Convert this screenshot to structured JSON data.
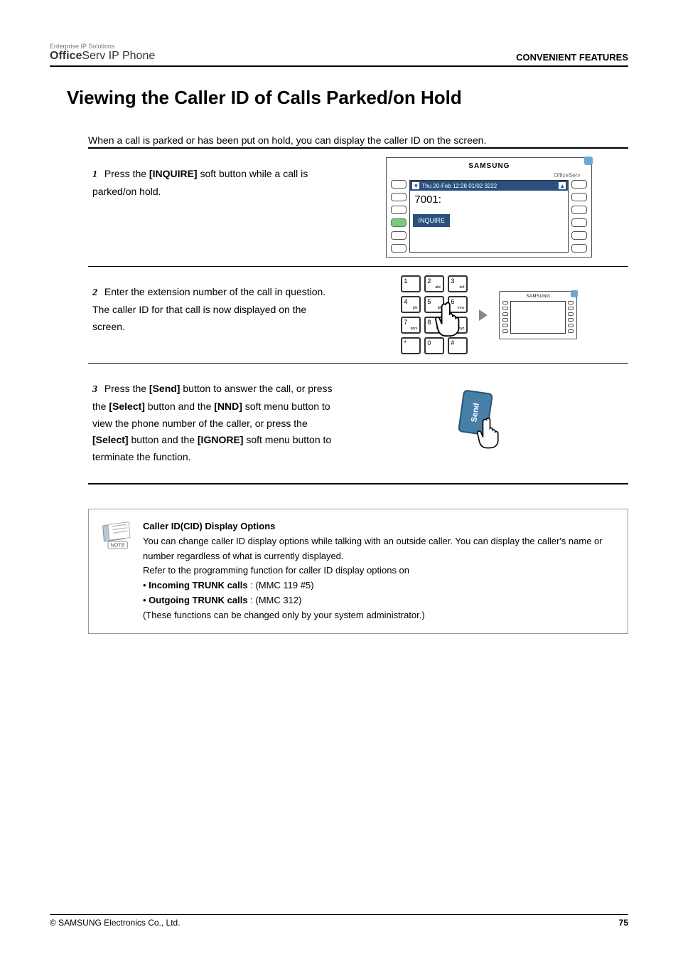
{
  "header": {
    "logo_sub": "Enterprise IP Solutions",
    "logo_main_a": "Office",
    "logo_main_b": "Serv",
    "logo_main_c": " IP Phone",
    "section": "CONVENIENT FEATURES"
  },
  "title": "Viewing the Caller ID of Calls Parked/on Hold",
  "intro": "When a call is parked or has been put on hold, you can display the caller ID on the screen.",
  "step1": {
    "num": "1",
    "text_a": "Press the ",
    "bracket": "[INQUIRE]",
    "text_b": " soft button while a call is parked/on hold."
  },
  "step2": {
    "num": "2",
    "text": "Enter the extension number of the call in question. The caller ID for that call is now displayed on the screen."
  },
  "step3": {
    "num": "3",
    "text_a": "Press the ",
    "send": "[Send]",
    "text_b": " button to answer the call, or press the ",
    "select1": "[Select]",
    "text_c": " button and the ",
    "nnd": "[NND]",
    "text_d": " soft menu button to view the phone number of the caller, or press the ",
    "select2": "[Select]",
    "text_e": " button and the ",
    "ignore": "[IGNORE]",
    "text_f": " soft menu button to terminate the function."
  },
  "phone1": {
    "brand": "SAMSUNG",
    "subtitle": "OfficeServ",
    "topbar": "Thu 20-Feb 12:28  01/02       3222",
    "line1": "7001:",
    "inquire": "INQUIRE"
  },
  "keys": [
    "1",
    "2",
    "3",
    "4",
    "5",
    "6",
    "7",
    "8",
    "9",
    "*",
    "0",
    "#"
  ],
  "key_subs": [
    "",
    "abc",
    "def",
    "ghi",
    "jkl",
    "mno",
    "pqrs",
    "tuv",
    "wxyz",
    "",
    "",
    ""
  ],
  "mini_brand": "SAMSUNG",
  "send_label": "Send",
  "note": {
    "title": "Caller ID(CID) Display Options",
    "p1": "You can change caller ID display options while talking with an outside caller. You can display the caller's name or number regardless of what is currently displayed.",
    "p2": "Refer to the programming function for caller ID display options on",
    "bullet1_a": "Incoming TRUNK calls",
    "bullet1_b": " : (MMC 119 #5)",
    "bullet2_a": "Outgoing TRUNK calls",
    "bullet2_b": " : (MMC 312)",
    "p3": "(These functions can be changed only by your system administrator.)"
  },
  "footer": {
    "left": "© SAMSUNG Electronics Co., Ltd.",
    "right": "75"
  }
}
